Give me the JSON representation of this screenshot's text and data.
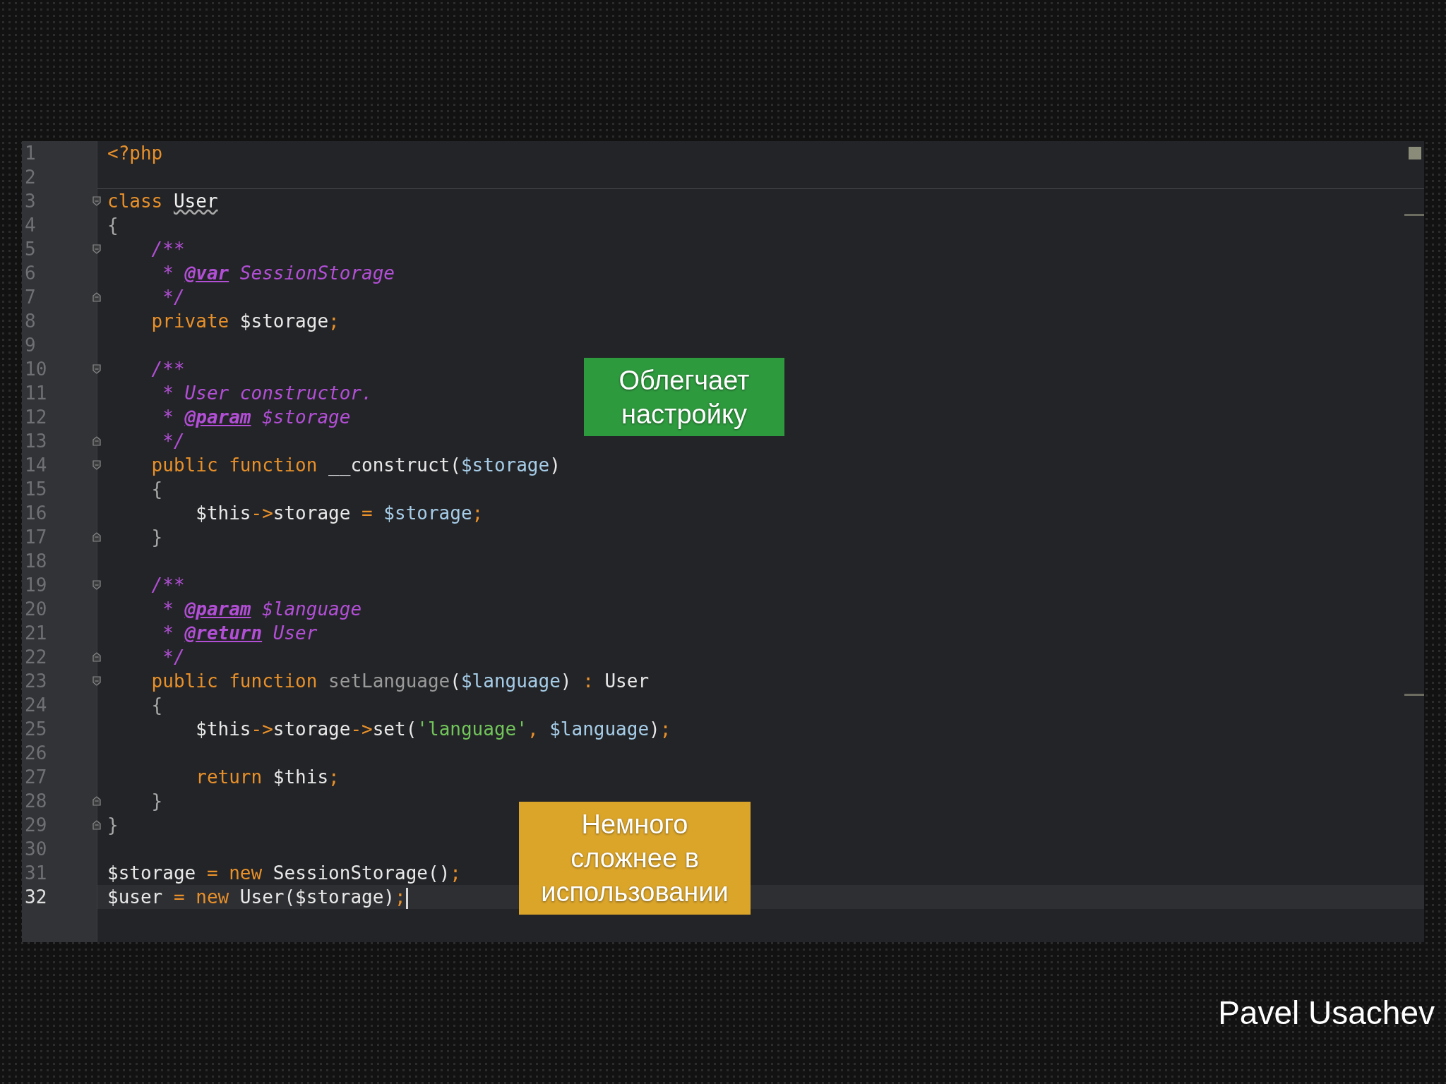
{
  "editor": {
    "lines": [
      {
        "number": "1",
        "fold_start": false,
        "fold_end": false,
        "current": false,
        "tokens": [
          {
            "kind": "keyword",
            "text": "<?php"
          }
        ]
      },
      {
        "number": "2",
        "fold_start": false,
        "fold_end": false,
        "current": false
      },
      {
        "number": "3",
        "fold_start": true,
        "fold_end": false,
        "current": false,
        "tokens": [
          {
            "kind": "keyword",
            "text": "class "
          },
          {
            "kind": "warned",
            "text": "User"
          }
        ]
      },
      {
        "number": "4",
        "fold_start": false,
        "fold_end": false,
        "current": false,
        "tokens": [
          {
            "kind": "brace",
            "text": "{"
          }
        ]
      },
      {
        "number": "5",
        "fold_start": true,
        "fold_end": false,
        "current": false,
        "tokens": [
          {
            "kind": "comment",
            "text": "    /**"
          }
        ]
      },
      {
        "number": "6",
        "fold_start": false,
        "fold_end": false,
        "current": false,
        "tokens": [
          {
            "kind": "comment",
            "text": "     * "
          },
          {
            "kind": "doctag",
            "text": "@var"
          },
          {
            "kind": "comment",
            "text": " SessionStorage"
          }
        ]
      },
      {
        "number": "7",
        "fold_start": false,
        "fold_end": true,
        "current": false,
        "tokens": [
          {
            "kind": "comment",
            "text": "     */"
          }
        ]
      },
      {
        "number": "8",
        "fold_start": false,
        "fold_end": false,
        "current": false,
        "tokens": [
          {
            "kind": "keyword",
            "text": "    private"
          },
          {
            "kind": "plain",
            "text": " $storage"
          },
          {
            "kind": "keyword",
            "text": ";"
          }
        ]
      },
      {
        "number": "9",
        "fold_start": false,
        "fold_end": false,
        "current": false
      },
      {
        "number": "10",
        "fold_start": true,
        "fold_end": false,
        "current": false,
        "tokens": [
          {
            "kind": "comment",
            "text": "    /**"
          }
        ]
      },
      {
        "number": "11",
        "fold_start": false,
        "fold_end": false,
        "current": false,
        "tokens": [
          {
            "kind": "comment",
            "text": "     * User constructor."
          }
        ]
      },
      {
        "number": "12",
        "fold_start": false,
        "fold_end": false,
        "current": false,
        "tokens": [
          {
            "kind": "comment",
            "text": "     * "
          },
          {
            "kind": "doctag",
            "text": "@param"
          },
          {
            "kind": "comment",
            "text": " $storage"
          }
        ]
      },
      {
        "number": "13",
        "fold_start": false,
        "fold_end": true,
        "current": false,
        "tokens": [
          {
            "kind": "comment",
            "text": "     */"
          }
        ]
      },
      {
        "number": "14",
        "fold_start": true,
        "fold_end": false,
        "current": false,
        "tokens": [
          {
            "kind": "keyword",
            "text": "    public function"
          },
          {
            "kind": "plain",
            "text": " __construct("
          },
          {
            "kind": "variable",
            "text": "$storage"
          },
          {
            "kind": "plain",
            "text": ")"
          }
        ]
      },
      {
        "number": "15",
        "fold_start": false,
        "fold_end": false,
        "current": false,
        "tokens": [
          {
            "kind": "brace",
            "text": "    {"
          }
        ]
      },
      {
        "number": "16",
        "fold_start": false,
        "fold_end": false,
        "current": false,
        "tokens": [
          {
            "kind": "plain",
            "text": "        $this"
          },
          {
            "kind": "keyword",
            "text": "->"
          },
          {
            "kind": "plain",
            "text": "storage "
          },
          {
            "kind": "keyword",
            "text": "="
          },
          {
            "kind": "variable",
            "text": " $storage"
          },
          {
            "kind": "keyword",
            "text": ";"
          }
        ]
      },
      {
        "number": "17",
        "fold_start": false,
        "fold_end": true,
        "current": false,
        "tokens": [
          {
            "kind": "brace",
            "text": "    }"
          }
        ]
      },
      {
        "number": "18",
        "fold_start": false,
        "fold_end": false,
        "current": false
      },
      {
        "number": "19",
        "fold_start": true,
        "fold_end": false,
        "current": false,
        "tokens": [
          {
            "kind": "comment",
            "text": "    /**"
          }
        ]
      },
      {
        "number": "20",
        "fold_start": false,
        "fold_end": false,
        "current": false,
        "tokens": [
          {
            "kind": "comment",
            "text": "     * "
          },
          {
            "kind": "doctag",
            "text": "@param"
          },
          {
            "kind": "comment",
            "text": " $language"
          }
        ]
      },
      {
        "number": "21",
        "fold_start": false,
        "fold_end": false,
        "current": false,
        "tokens": [
          {
            "kind": "comment",
            "text": "     * "
          },
          {
            "kind": "doctag",
            "text": "@return"
          },
          {
            "kind": "comment",
            "text": " User"
          }
        ]
      },
      {
        "number": "22",
        "fold_start": false,
        "fold_end": true,
        "current": false,
        "tokens": [
          {
            "kind": "comment",
            "text": "     */"
          }
        ]
      },
      {
        "number": "23",
        "fold_start": true,
        "fold_end": false,
        "current": false,
        "tokens": [
          {
            "kind": "keyword",
            "text": "    public function"
          },
          {
            "kind": "method",
            "text": " setLanguage"
          },
          {
            "kind": "plain",
            "text": "("
          },
          {
            "kind": "variable",
            "text": "$language"
          },
          {
            "kind": "plain",
            "text": ") "
          },
          {
            "kind": "keyword",
            "text": ":"
          },
          {
            "kind": "plain",
            "text": " User"
          }
        ]
      },
      {
        "number": "24",
        "fold_start": false,
        "fold_end": false,
        "current": false,
        "tokens": [
          {
            "kind": "brace",
            "text": "    {"
          }
        ]
      },
      {
        "number": "25",
        "fold_start": false,
        "fold_end": false,
        "current": false,
        "tokens": [
          {
            "kind": "plain",
            "text": "        $this"
          },
          {
            "kind": "keyword",
            "text": "->"
          },
          {
            "kind": "plain",
            "text": "storage"
          },
          {
            "kind": "keyword",
            "text": "->"
          },
          {
            "kind": "plain",
            "text": "set("
          },
          {
            "kind": "string",
            "text": "'language'"
          },
          {
            "kind": "keyword",
            "text": ","
          },
          {
            "kind": "variable",
            "text": " $language"
          },
          {
            "kind": "plain",
            "text": ")"
          },
          {
            "kind": "keyword",
            "text": ";"
          }
        ]
      },
      {
        "number": "26",
        "fold_start": false,
        "fold_end": false,
        "current": false
      },
      {
        "number": "27",
        "fold_start": false,
        "fold_end": false,
        "current": false,
        "tokens": [
          {
            "kind": "keyword",
            "text": "        return"
          },
          {
            "kind": "plain",
            "text": " $this"
          },
          {
            "kind": "keyword",
            "text": ";"
          }
        ]
      },
      {
        "number": "28",
        "fold_start": false,
        "fold_end": true,
        "current": false,
        "tokens": [
          {
            "kind": "brace",
            "text": "    }"
          }
        ]
      },
      {
        "number": "29",
        "fold_start": false,
        "fold_end": true,
        "current": false,
        "tokens": [
          {
            "kind": "brace",
            "text": "}"
          }
        ]
      },
      {
        "number": "30",
        "fold_start": false,
        "fold_end": false,
        "current": false
      },
      {
        "number": "31",
        "fold_start": false,
        "fold_end": false,
        "current": false,
        "tokens": [
          {
            "kind": "plain",
            "text": "$storage "
          },
          {
            "kind": "keyword",
            "text": "= new"
          },
          {
            "kind": "plain",
            "text": " SessionStorage()"
          },
          {
            "kind": "keyword",
            "text": ";"
          }
        ]
      },
      {
        "number": "32",
        "fold_start": false,
        "fold_end": false,
        "current": true,
        "tokens": [
          {
            "kind": "plain",
            "text": "$user "
          },
          {
            "kind": "keyword",
            "text": "= new"
          },
          {
            "kind": "plain",
            "text": " User($storage)"
          },
          {
            "kind": "keyword",
            "text": ";"
          }
        ]
      }
    ]
  },
  "callouts": [
    {
      "text": "Облегчает настройку",
      "color": "#2e9a3e"
    },
    {
      "text": "Немного сложнее в использовании",
      "color": "#dba52a"
    }
  ],
  "author": "Pavel Usachev"
}
